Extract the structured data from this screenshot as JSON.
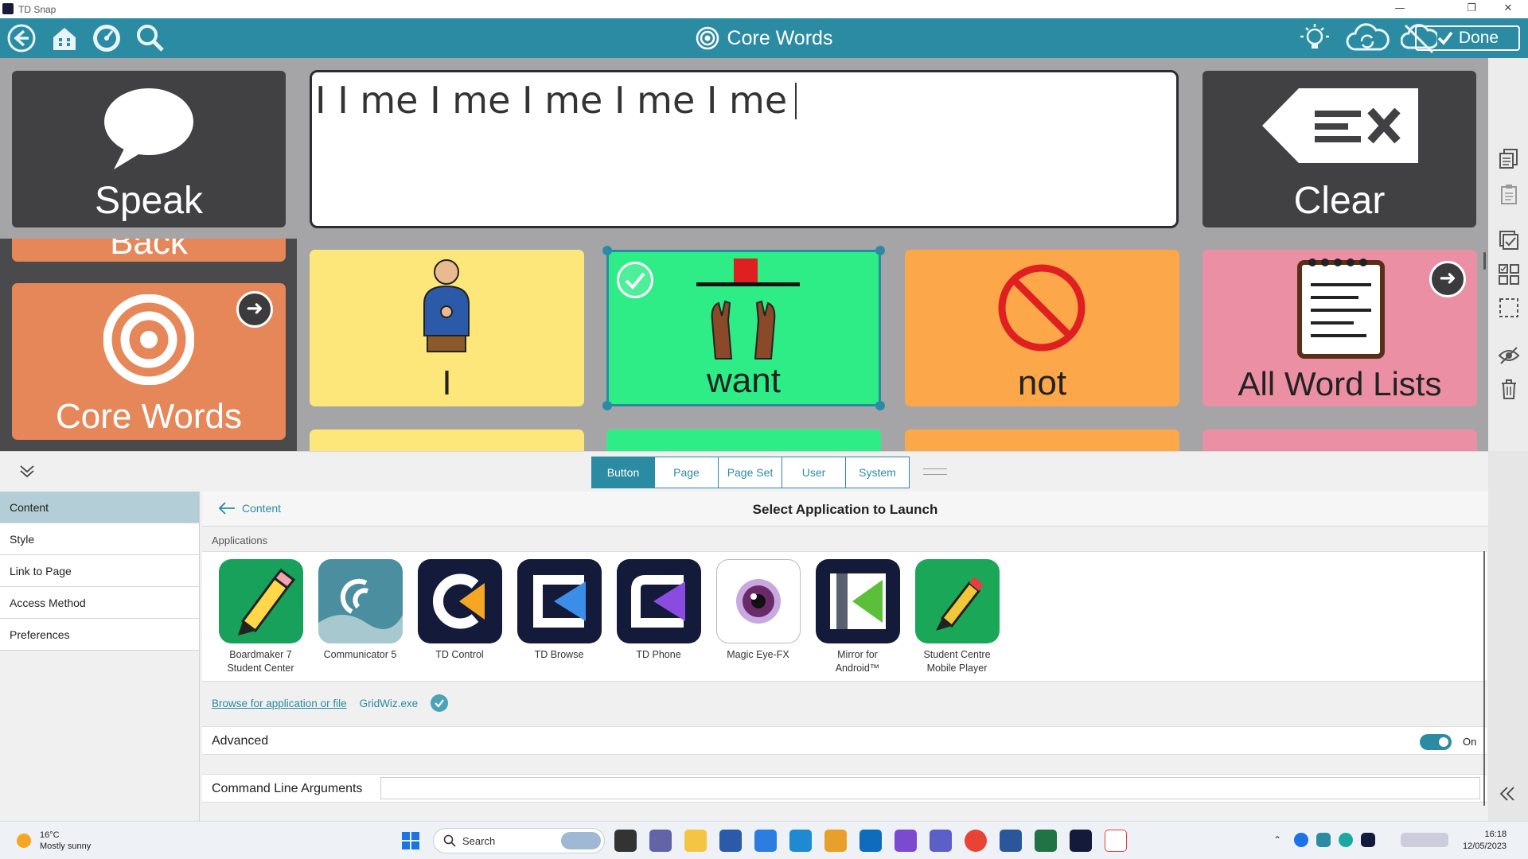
{
  "window": {
    "title": "TD Snap",
    "minimize": "—",
    "restore": "❐",
    "close": "✕"
  },
  "header": {
    "back_icon": "back-arrow-icon",
    "home_icon": "home-icon",
    "dashboard_icon": "dashboard-icon",
    "search_icon": "search-icon",
    "page_title": "Core Words",
    "done_label": "Done",
    "accent": "#2b8ba3"
  },
  "message_bar": {
    "text": "I I me I me I me I me I me"
  },
  "speak": {
    "label": "Speak"
  },
  "clear": {
    "label": "Clear"
  },
  "left_column": {
    "back_label": "Back",
    "core_words_label": "Core Words"
  },
  "grid": {
    "tiles": [
      {
        "label": "I",
        "color": "#fde67a"
      },
      {
        "label": "want",
        "color": "#2eed87"
      },
      {
        "label": "not",
        "color": "#fca84a"
      },
      {
        "label": "All Word Lists",
        "color": "#eb8fa4"
      }
    ]
  },
  "panel": {
    "tabs": [
      "Button",
      "Page",
      "Page Set",
      "User",
      "System"
    ],
    "active_tab": "Button",
    "side_items": [
      "Content",
      "Style",
      "Link to Page",
      "Access Method",
      "Preferences"
    ],
    "crumb_back": "Content",
    "heading": "Select Application to Launch",
    "applications_label": "Applications",
    "apps": [
      {
        "name1": "Boardmaker 7",
        "name2": "Student Center"
      },
      {
        "name1": "Communicator 5",
        "name2": ""
      },
      {
        "name1": "TD Control",
        "name2": ""
      },
      {
        "name1": "TD Browse",
        "name2": ""
      },
      {
        "name1": "TD Phone",
        "name2": ""
      },
      {
        "name1": "Magic Eye-FX",
        "name2": ""
      },
      {
        "name1": "Mirror for",
        "name2": "Android™"
      },
      {
        "name1": "Student Centre",
        "name2": "Mobile Player"
      }
    ],
    "browse_link": "Browse for application or file",
    "selected_file": "GridWiz.exe",
    "advanced_label": "Advanced",
    "advanced_state": "On",
    "cmd_label": "Command Line Arguments",
    "cmd_value": ""
  },
  "taskbar": {
    "weather_temp": "16°C",
    "weather_desc": "Mostly sunny",
    "search_placeholder": "Search",
    "time": "16:18",
    "date": "12/05/2023"
  }
}
